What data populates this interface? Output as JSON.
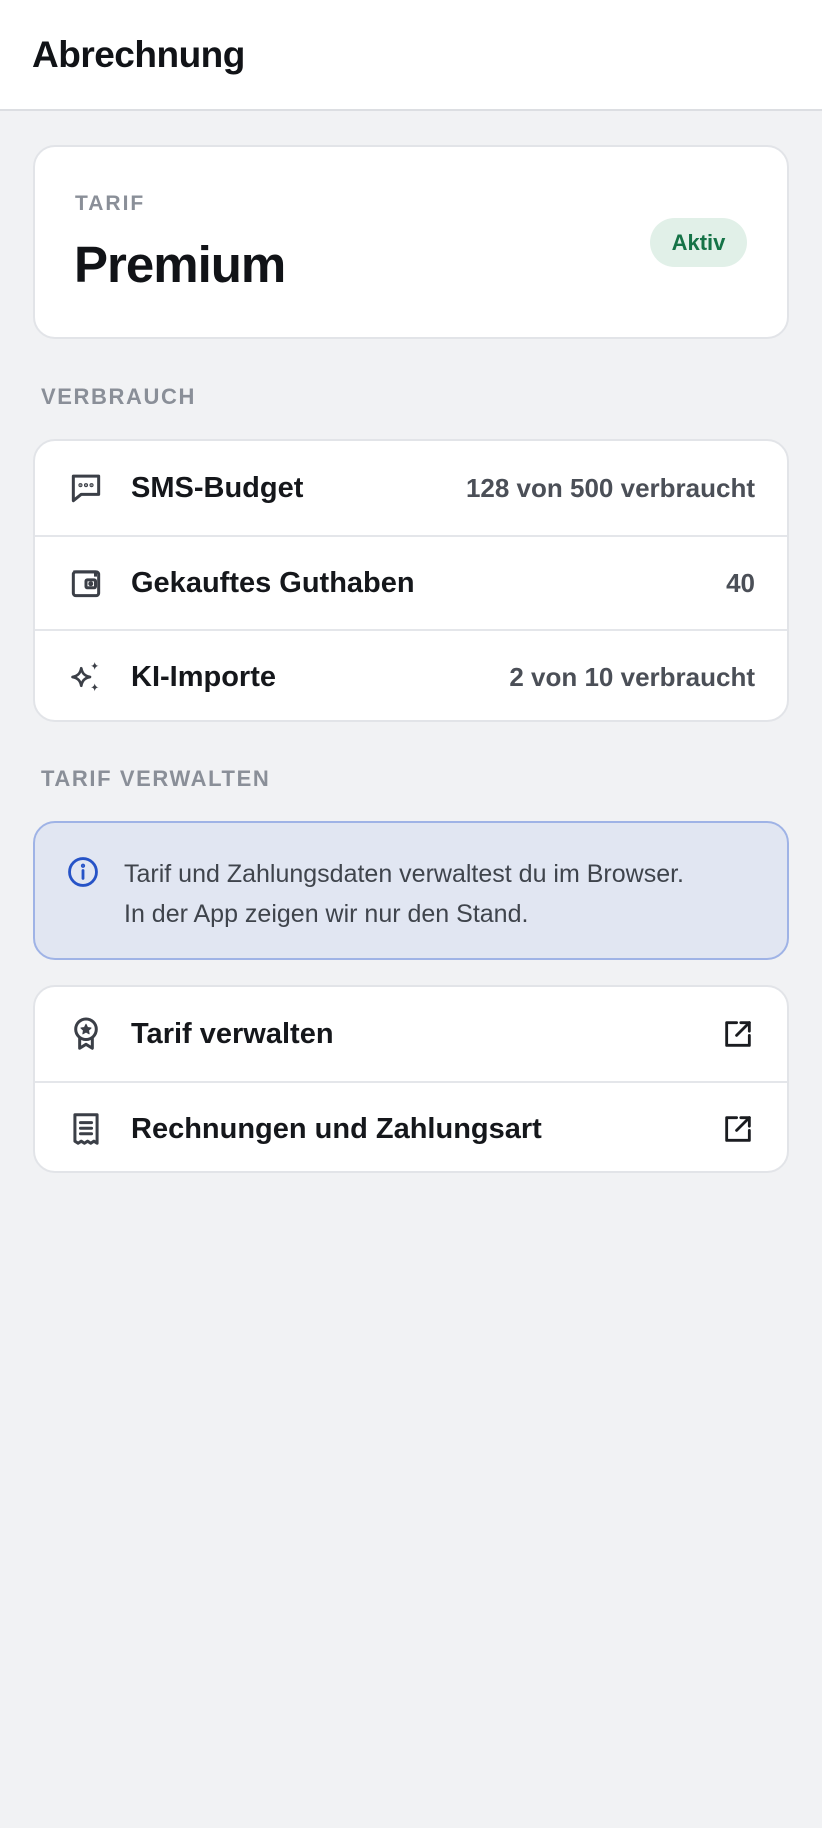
{
  "header": {
    "title": "Abrechnung"
  },
  "plan": {
    "eyebrow": "TARIF",
    "name": "Premium",
    "status": "Aktiv",
    "status_color": "#157347"
  },
  "usage": {
    "section_label": "VERBRAUCH",
    "items": [
      {
        "icon": "sms-icon",
        "label": "SMS-Budget",
        "value": "128 von 500 verbraucht"
      },
      {
        "icon": "wallet-icon",
        "label": "Gekauftes Guthaben",
        "value": "40"
      },
      {
        "icon": "sparkles-icon",
        "label": "KI-Importe",
        "value": "2 von 10 verbraucht"
      }
    ]
  },
  "manage": {
    "section_label": "TARIF VERWALTEN",
    "info_line1": "Tarif und Zahlungsdaten verwaltest du im Browser.",
    "info_line2": "In der App zeigen wir nur den Stand.",
    "links": [
      {
        "icon": "award-icon",
        "label": "Tarif verwalten",
        "trailing_icon": "external-link-icon"
      },
      {
        "icon": "receipt-icon",
        "label": "Rechnungen und Zahlungsart",
        "trailing_icon": "external-link-icon"
      }
    ]
  },
  "colors": {
    "accent_blue": "#2653c7",
    "background": "#f1f2f4"
  }
}
